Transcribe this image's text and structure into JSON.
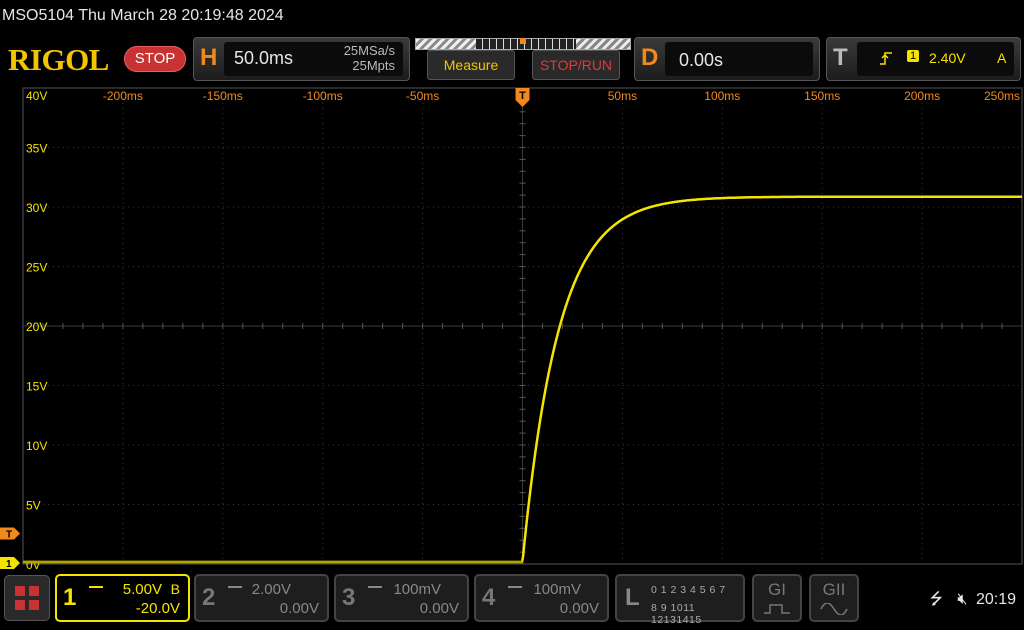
{
  "title": "MSO5104  Thu March 28 20:19:48 2024",
  "logo": "RIGOL",
  "run_state": "STOP",
  "horizontal": {
    "letter": "H",
    "timebase": "50.0ms",
    "sample_rate": "25MSa/s",
    "memory_depth": "25Mpts"
  },
  "buttons": {
    "measure": "Measure",
    "stop_run": "STOP/RUN"
  },
  "delay": {
    "letter": "D",
    "value": "0.00s"
  },
  "trigger": {
    "letter": "T",
    "channel": "1",
    "level": "2.40V",
    "mode": "A"
  },
  "grid": {
    "time_labels": [
      "-200ms",
      "-150ms",
      "-100ms",
      "-50ms",
      "50ms",
      "100ms",
      "150ms",
      "200ms",
      "250ms"
    ],
    "volt_labels": [
      "40V",
      "35V",
      "30V",
      "25V",
      "20V",
      "15V",
      "10V",
      "5V",
      "0V"
    ],
    "trigger_marker": "T",
    "ch1_marker": "1",
    "trig_level_marker": "T"
  },
  "colors": {
    "ch1": "#f5e400",
    "accent": "#f08a1c",
    "grid": "#3a3a3a",
    "stop": "#c83232"
  },
  "waveform": {
    "x_unit": "ms",
    "y_unit": "V",
    "t_start": 0,
    "final": 30.7,
    "tau": 18,
    "pre_level": 0
  },
  "channels": [
    {
      "num": "1",
      "scale": "5.00V",
      "offset": "-20.0V",
      "bw": "B",
      "active": true
    },
    {
      "num": "2",
      "scale": "2.00V",
      "offset": "0.00V",
      "active": false
    },
    {
      "num": "3",
      "scale": "100mV",
      "offset": "0.00V",
      "active": false
    },
    {
      "num": "4",
      "scale": "100mV",
      "offset": "0.00V",
      "active": false
    }
  ],
  "logic": {
    "label": "L",
    "row1": "0 1 2 3   4 5 6 7",
    "row2": "8 9 1011  12131415"
  },
  "generators": [
    "GI",
    "GII"
  ],
  "status": {
    "time": "20:19"
  }
}
